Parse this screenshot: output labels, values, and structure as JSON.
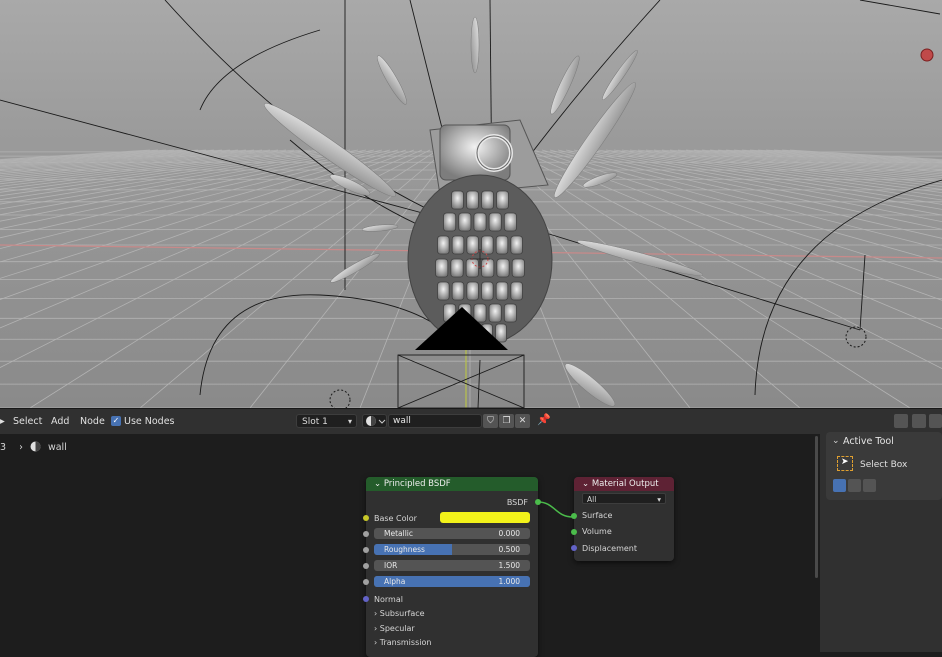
{
  "header": {
    "menus": [
      "Select",
      "Add",
      "Node"
    ],
    "use_nodes_label": "Use Nodes",
    "slot": "Slot 1",
    "material_name": "wall"
  },
  "breadcrumb": {
    "prefix": "3",
    "material": "wall"
  },
  "nodes": {
    "principled": {
      "title": "Principled BSDF",
      "output": "BSDF",
      "base_color_label": "Base Color",
      "base_color": "#f2f21a",
      "metallic_label": "Metallic",
      "metallic": "0.000",
      "roughness_label": "Roughness",
      "roughness": "0.500",
      "roughness_fill": 0.5,
      "ior_label": "IOR",
      "ior": "1.500",
      "alpha_label": "Alpha",
      "alpha": "1.000",
      "alpha_fill": 1.0,
      "normal_label": "Normal",
      "subsurface_label": "Subsurface",
      "specular_label": "Specular",
      "transmission_label": "Transmission"
    },
    "output": {
      "title": "Material Output",
      "target": "All",
      "surface": "Surface",
      "volume": "Volume",
      "displacement": "Displacement"
    }
  },
  "sidebar": {
    "panel_title": "Active Tool",
    "tool_name": "Select Box"
  },
  "colors": {
    "principled_header": "#245c2b",
    "output_header": "#5e2234",
    "accent": "#4772b3"
  }
}
